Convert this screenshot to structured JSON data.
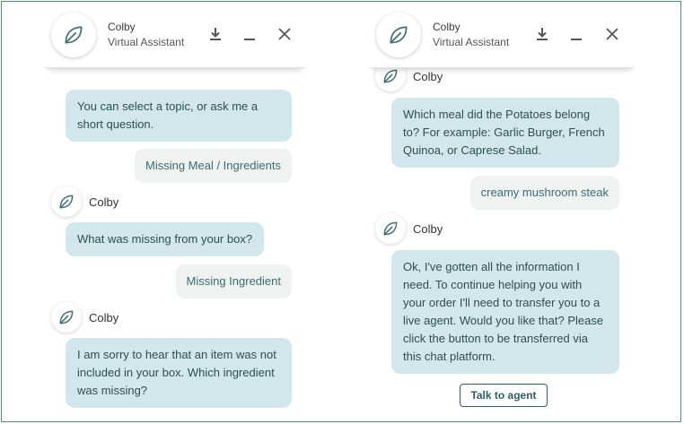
{
  "left": {
    "header": {
      "name": "Colby",
      "subtitle": "Virtual Assistant"
    },
    "messages": {
      "bot1": "You can select a topic, or ask me a short question.",
      "user1": "Missing Meal / Ingredients",
      "bot2_name": "Colby",
      "bot2": "What was missing from your box?",
      "user2": "Missing Ingredient",
      "bot3_name": "Colby",
      "bot3": "I am sorry to hear that an item was not included in your box. Which ingredient was missing?"
    }
  },
  "right": {
    "header": {
      "name": "Colby",
      "subtitle": "Virtual Assistant"
    },
    "messages": {
      "bot1_name": "Colby",
      "bot1": "Which meal did the Potatoes belong to? For example: Garlic Burger, French Quinoa, or Caprese Salad.",
      "user1": "creamy mushroom steak",
      "bot2_name": "Colby",
      "bot2": "Ok, I've gotten all the information I need. To continue helping you with your order I'll need to transfer you to a live agent. Would you like that? Please click the button to be transferred via this chat platform.",
      "talk_button": "Talk to agent"
    }
  },
  "icons": {
    "avatar": "leaf-icon",
    "download": "download-icon",
    "minimize": "minimize-icon",
    "close": "close-icon"
  },
  "colors": {
    "bot_bubble": "#d2e7ec",
    "user_bubble": "#f0f1f1",
    "accent": "#2f5f63",
    "frame": "#4a9b6b"
  }
}
